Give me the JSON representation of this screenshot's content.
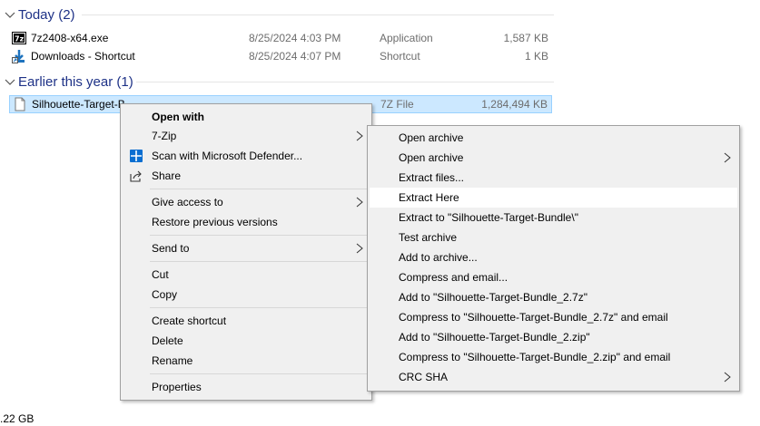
{
  "groups": [
    {
      "label": "Today (2)"
    },
    {
      "label": "Earlier this year (1)"
    }
  ],
  "files": [
    {
      "name": "7z2408-x64.exe",
      "date": "8/25/2024 4:03 PM",
      "type": "Application",
      "size": "1,587 KB",
      "icon": "7zip-exe-icon"
    },
    {
      "name": "Downloads - Shortcut",
      "date": "8/25/2024 4:07 PM",
      "type": "Shortcut",
      "size": "1 KB",
      "icon": "shortcut-download-icon"
    },
    {
      "name": "Silhouette-Target-B",
      "date": "",
      "type": "7Z File",
      "size": "1,284,494 KB",
      "icon": "blank-file-icon"
    }
  ],
  "status_text": ".22 GB",
  "context_menu": {
    "items": [
      {
        "label": "Open with"
      },
      {
        "label": "7-Zip",
        "submenu": true
      },
      {
        "label": "Scan with Microsoft Defender...",
        "icon": "defender-shield-icon"
      },
      {
        "label": "Share",
        "icon": "share-icon"
      },
      {
        "label": "Give access to",
        "submenu": true
      },
      {
        "label": "Restore previous versions"
      },
      {
        "label": "Send to",
        "submenu": true
      },
      {
        "label": "Cut"
      },
      {
        "label": "Copy"
      },
      {
        "label": "Create shortcut"
      },
      {
        "label": "Delete"
      },
      {
        "label": "Rename"
      },
      {
        "label": "Properties"
      }
    ]
  },
  "sevenzip_menu": {
    "items": [
      {
        "label": "Open archive"
      },
      {
        "label": "Open archive",
        "submenu": true
      },
      {
        "label": "Extract files..."
      },
      {
        "label": "Extract Here",
        "highlighted": true
      },
      {
        "label": "Extract to \"Silhouette-Target-Bundle\\\""
      },
      {
        "label": "Test archive"
      },
      {
        "label": "Add to archive..."
      },
      {
        "label": "Compress and email..."
      },
      {
        "label": "Add to \"Silhouette-Target-Bundle_2.7z\""
      },
      {
        "label": "Compress to \"Silhouette-Target-Bundle_2.7z\" and email"
      },
      {
        "label": "Add to \"Silhouette-Target-Bundle_2.zip\""
      },
      {
        "label": "Compress to \"Silhouette-Target-Bundle_2.zip\" and email"
      },
      {
        "label": "CRC SHA",
        "submenu": true
      }
    ]
  }
}
